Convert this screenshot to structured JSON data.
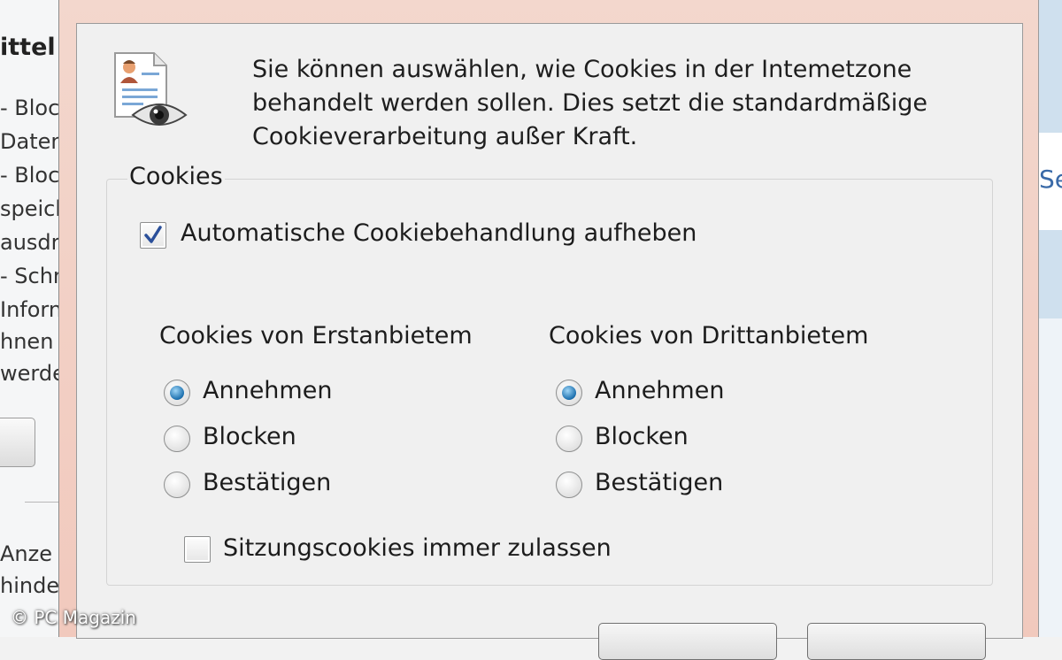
{
  "background": {
    "left_title": "ittel",
    "left_lines": [
      "- Bloc",
      "Daten",
      "- Bloc",
      "speich",
      "ausdr",
      "- Schr",
      "Inforn",
      "hnen",
      "werde",
      "Anze",
      "hinde"
    ],
    "right_text": "Se"
  },
  "watermark": "© PC Magazin",
  "dialog": {
    "icon": "document-privacy-eye-icon",
    "description_lines": [
      "Sie können auswählen, wie Cookies in der Intemetzone",
      "behandelt werden sollen. Dies setzt die standardmäßige",
      "Cookieverarbeitung außer Kraft."
    ],
    "group_label": "Cookies",
    "override_checkbox": {
      "label": "Automatische Cookiebehandlung aufheben",
      "checked": true
    },
    "first_party": {
      "heading": "Cookies von Erstanbietem",
      "options": [
        "Annehmen",
        "Blocken",
        "Bestätigen"
      ],
      "selected": "Annehmen"
    },
    "third_party": {
      "heading": "Cookies von Drittanbietem",
      "options": [
        "Annehmen",
        "Blocken",
        "Bestätigen"
      ],
      "selected": "Annehmen"
    },
    "session_checkbox": {
      "label": "Sitzungscookies immer zulassen",
      "checked": false
    }
  },
  "colors": {
    "frame": "#f1c9bd",
    "client": "#f0f0f0",
    "radio_selected": "#1b6fae",
    "check_mark": "#2a4f9a"
  }
}
